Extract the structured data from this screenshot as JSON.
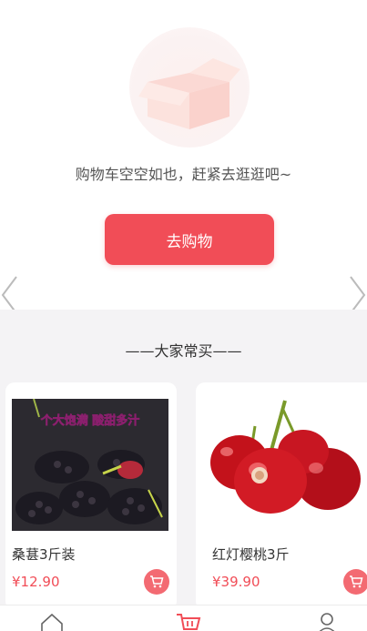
{
  "empty_cart": {
    "message": "购物车空空如也，赶紧去逛逛吧~",
    "go_shopping_label": "去购物"
  },
  "recommend": {
    "title": "——大家常买——",
    "products": [
      {
        "name": "桑葚3斤装",
        "price": "¥12.90",
        "image_banner": "个大饱满 酸甜多汁"
      },
      {
        "name": "红灯樱桃3斤",
        "price": "¥39.90"
      }
    ]
  },
  "colors": {
    "accent": "#f14d57",
    "background_gray": "#f4f3f5"
  }
}
